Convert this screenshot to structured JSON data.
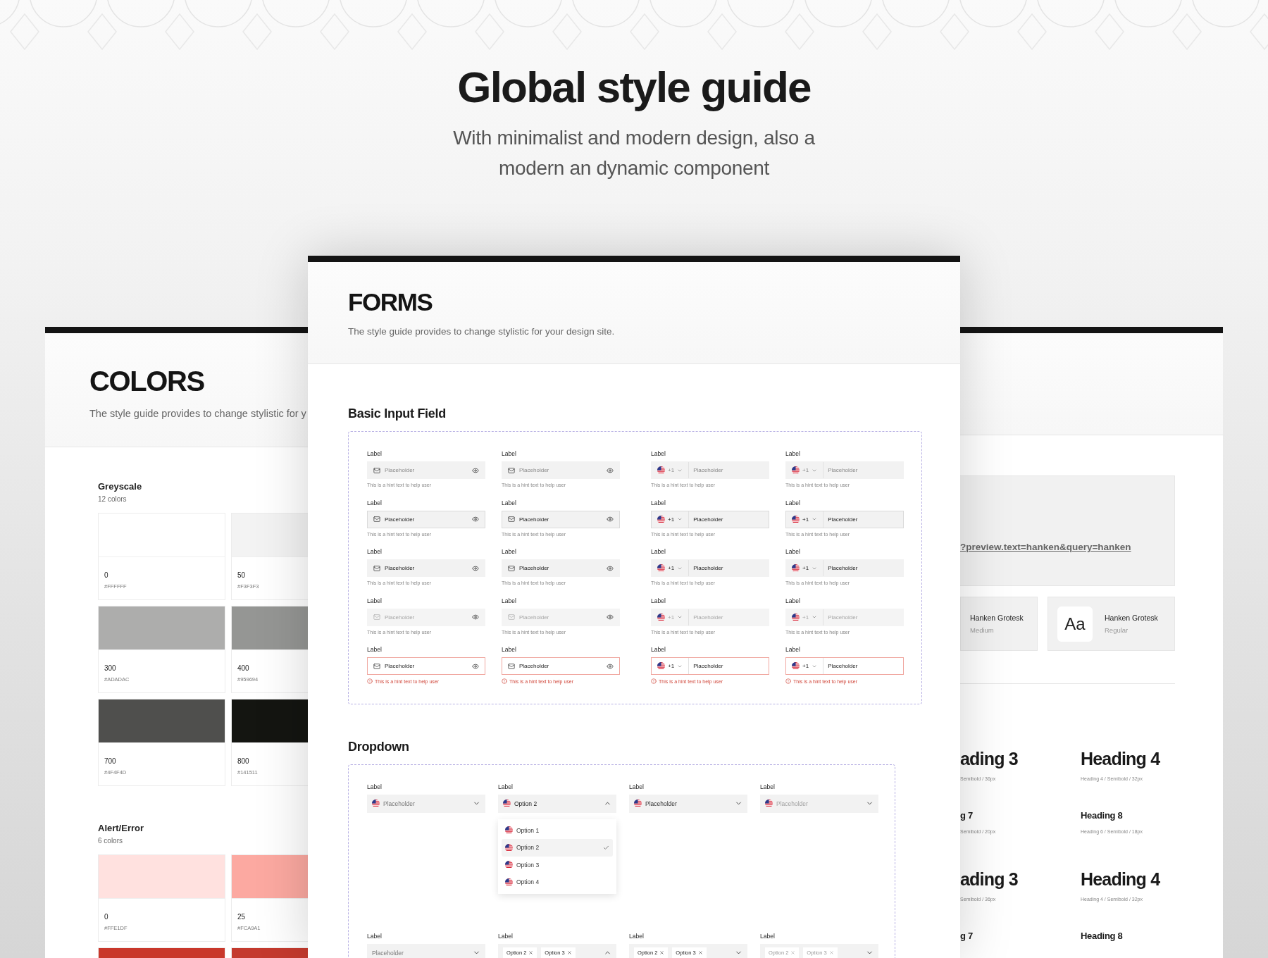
{
  "header": {
    "title": "Global style guide",
    "subtitle": "With minimalist and modern design, also a modern an dynamic component"
  },
  "colors_panel": {
    "title": "COLORS",
    "description": "The style guide provides to change stylistic for y",
    "groups": [
      {
        "name": "Greyscale",
        "count": "12 colors",
        "swatches": [
          {
            "name": "0",
            "hex": "#FFFFFF",
            "color": "#ffffff"
          },
          {
            "name": "50",
            "hex": "#F3F3F3",
            "color": "#f3f3f3"
          },
          {
            "name": "300",
            "hex": "#ADADAC",
            "color": "#adadac"
          },
          {
            "name": "400",
            "hex": "#959694",
            "color": "#959694"
          },
          {
            "name": "700",
            "hex": "#4F4F4D",
            "color": "#4f4f4d"
          },
          {
            "name": "800",
            "hex": "#141511",
            "color": "#141511"
          }
        ]
      },
      {
        "name": "Alert/Error",
        "count": "6 colors",
        "swatches": [
          {
            "name": "0",
            "hex": "#FFE1DF",
            "color": "#ffe1df"
          },
          {
            "name": "25",
            "hex": "#FCA9A1",
            "color": "#fca9a1"
          },
          {
            "color": "#c9382b"
          },
          {
            "color": "#c43a2e"
          }
        ]
      }
    ]
  },
  "forms_panel": {
    "title": "FORMS",
    "description": "The style guide provides to change stylistic for your design site.",
    "basic_input": {
      "title": "Basic Input Field",
      "columns": [
        {
          "kind": "icon",
          "fields": [
            {
              "label": "Label",
              "placeholder": "Placeholder",
              "hint": "This is a hint text to help user",
              "kind": "default"
            },
            {
              "label": "Label",
              "placeholder": "Placeholder",
              "hint": "This is a hint text to help user",
              "kind": "focused"
            },
            {
              "label": "Label",
              "placeholder": "Placeholder",
              "hint": "This is a hint text to help user",
              "kind": "filled"
            },
            {
              "label": "Label",
              "placeholder": "Placeholder",
              "hint": "This is a hint text to help user",
              "kind": "disabled"
            },
            {
              "label": "Label",
              "placeholder": "Placeholder",
              "hint": "This is a hint text to help user",
              "kind": "error"
            }
          ]
        },
        {
          "kind": "icon",
          "fields": [
            {
              "label": "Label",
              "placeholder": "Placeholder",
              "hint": "This is a hint text to help user",
              "kind": "default"
            },
            {
              "label": "Label",
              "placeholder": "Placeholder",
              "hint": "This is a hint text to help user",
              "kind": "focused"
            },
            {
              "label": "Label",
              "placeholder": "Placeholder",
              "hint": "This is a hint text to help user",
              "kind": "filled"
            },
            {
              "label": "Label",
              "placeholder": "Placeholder",
              "hint": "This is a hint text to help user",
              "kind": "disabled"
            },
            {
              "label": "Label",
              "placeholder": "Placeholder",
              "hint": "This is a hint text to help user",
              "kind": "error"
            }
          ]
        },
        {
          "kind": "phone",
          "fields": [
            {
              "label": "Label",
              "prefix": "+1",
              "placeholder": "Placeholder",
              "hint": "This is a hint text to help user",
              "kind": "default"
            },
            {
              "label": "Label",
              "prefix": "+1",
              "placeholder": "Placeholder",
              "hint": "This is a hint text to help user",
              "kind": "focused"
            },
            {
              "label": "Label",
              "prefix": "+1",
              "placeholder": "Placeholder",
              "hint": "This is a hint text to help user",
              "kind": "filled"
            },
            {
              "label": "Label",
              "prefix": "+1",
              "placeholder": "Placeholder",
              "hint": "This is a hint text to help user",
              "kind": "disabled"
            },
            {
              "label": "Label",
              "prefix": "+1",
              "placeholder": "Placeholder",
              "hint": "This is a hint text to help user",
              "kind": "error"
            }
          ]
        },
        {
          "kind": "phone",
          "fields": [
            {
              "label": "Label",
              "prefix": "+1",
              "placeholder": "Placeholder",
              "hint": "This is a hint text to help user",
              "kind": "default"
            },
            {
              "label": "Label",
              "prefix": "+1",
              "placeholder": "Placeholder",
              "hint": "This is a hint text to help user",
              "kind": "focused"
            },
            {
              "label": "Label",
              "prefix": "+1",
              "placeholder": "Placeholder",
              "hint": "This is a hint text to help user",
              "kind": "filled"
            },
            {
              "label": "Label",
              "prefix": "+1",
              "placeholder": "Placeholder",
              "hint": "This is a hint text to help user",
              "kind": "disabled"
            },
            {
              "label": "Label",
              "prefix": "+1",
              "placeholder": "Placeholder",
              "hint": "This is a hint text to help user",
              "kind": "error"
            }
          ]
        }
      ]
    },
    "dropdown": {
      "title": "Dropdown",
      "rows": [
        [
          {
            "label": "Label",
            "flag": true,
            "placeholder": "Placeholder",
            "kind": "default"
          },
          {
            "label": "Label",
            "flag": true,
            "value": "Option 2",
            "kind": "open",
            "options": [
              {
                "label": "Option 1",
                "selected": false
              },
              {
                "label": "Option 2",
                "selected": true
              },
              {
                "label": "Option 3",
                "selected": false
              },
              {
                "label": "Option 4",
                "selected": false
              }
            ]
          },
          {
            "label": "Label",
            "flag": true,
            "value": "Placeholder",
            "kind": "filled"
          },
          {
            "label": "Label",
            "flag": true,
            "placeholder": "Placeholder",
            "kind": "disabled"
          }
        ],
        [
          {
            "label": "Label",
            "flag": false,
            "placeholder": "Placeholder",
            "kind": "default"
          },
          {
            "label": "Label",
            "flag": false,
            "chips": [
              "Option 2",
              "Option 3"
            ],
            "kind": "open"
          },
          {
            "label": "Label",
            "flag": false,
            "chips": [
              "Option 2",
              "Option 3"
            ],
            "kind": "filled"
          },
          {
            "label": "Label",
            "flag": false,
            "chips": [
              "Option 2",
              "Option 3"
            ],
            "kind": "disabled"
          }
        ]
      ]
    }
  },
  "typography_panel": {
    "link": "?preview.text=hanken&query=hanken",
    "fonts": [
      {
        "name": "Hanken Grotesk",
        "weight": "Medium"
      },
      {
        "sample": "Aa",
        "name": "Hanken Grotesk",
        "weight": "Regular"
      }
    ],
    "headings": [
      {
        "kind": "large",
        "text": "ading 3",
        "spec": "Semibold / 36px"
      },
      {
        "kind": "large",
        "text": "Heading 4",
        "spec": "Heading 4 / Semibold / 32px"
      },
      {
        "kind": "small",
        "text": "g 7",
        "spec": "Semibold / 20px"
      },
      {
        "kind": "small",
        "text": "Heading 8",
        "spec": "Heading 6 / Semibold / 18px"
      },
      {
        "kind": "large",
        "text": "ading 3",
        "spec": "Semibold / 36px"
      },
      {
        "kind": "large",
        "text": "Heading 4",
        "spec": "Heading 4 / Semibold / 32px"
      },
      {
        "kind": "small",
        "text": "g 7"
      },
      {
        "kind": "small",
        "text": "Heading 8"
      }
    ]
  }
}
